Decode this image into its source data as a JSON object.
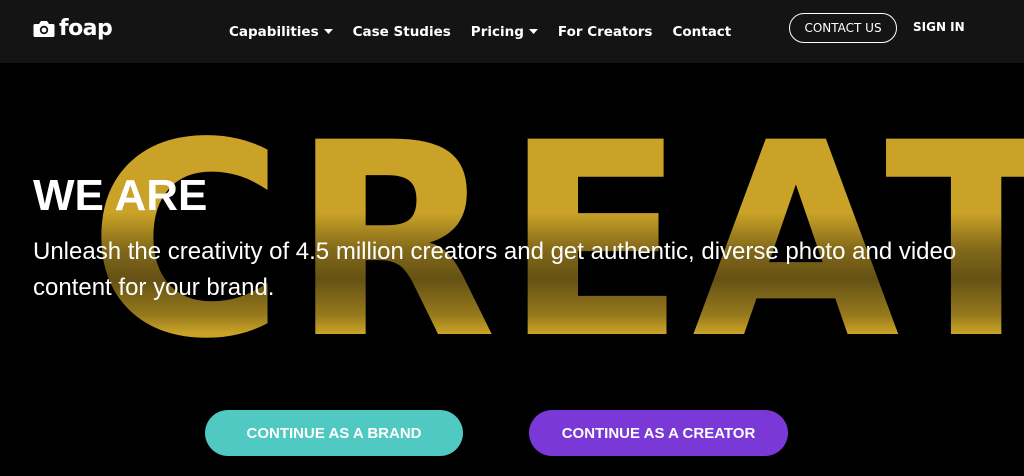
{
  "brand": {
    "logo_text": "foap",
    "logo_icon": "camera-icon"
  },
  "nav": {
    "items": [
      {
        "label": "Capabilities",
        "has_dropdown": true
      },
      {
        "label": "Case Studies",
        "has_dropdown": false
      },
      {
        "label": "Pricing",
        "has_dropdown": true
      },
      {
        "label": "For Creators",
        "has_dropdown": false
      },
      {
        "label": "Contact",
        "has_dropdown": false
      }
    ],
    "contact_button": "CONTACT US",
    "signin_link": "SIGN IN"
  },
  "hero": {
    "background_word": "CREATIV",
    "headline": "WE ARE",
    "subtitle": "Unleash the creativity of 4.5 million creators and get authentic, diverse photo and video content for your brand.",
    "cta_brand": "CONTINUE AS A BRAND",
    "cta_creator": "CONTINUE AS A CREATOR"
  },
  "colors": {
    "nav_bg": "#141414",
    "page_bg": "#000000",
    "gold": "#c9a227",
    "teal": "#4fc9c2",
    "purple": "#7a38d6"
  }
}
